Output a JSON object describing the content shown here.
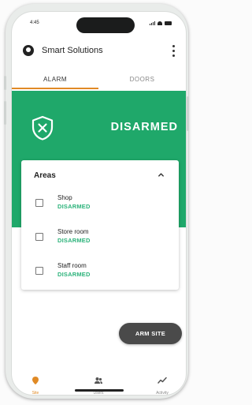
{
  "status_bar": {
    "time": "4:45"
  },
  "app_bar": {
    "title": "Smart Solutions"
  },
  "tabs": [
    {
      "label": "ALARM",
      "active": true
    },
    {
      "label": "DOORS",
      "active": false
    }
  ],
  "alarm": {
    "state": "DISARMED",
    "color": "#1fa86a"
  },
  "areas": {
    "title": "Areas",
    "items": [
      {
        "name": "Shop",
        "state": "DISARMED",
        "checked": false
      },
      {
        "name": "Store room",
        "state": "DISARMED",
        "checked": false
      },
      {
        "name": "Staff room",
        "state": "DISARMED",
        "checked": false
      }
    ]
  },
  "fab": {
    "label": "ARM SITE"
  },
  "bottom_nav": [
    {
      "label": "Site",
      "icon": "site-icon",
      "active": true
    },
    {
      "label": "Users",
      "icon": "users-icon",
      "active": false
    },
    {
      "label": "Activity",
      "icon": "activity-icon",
      "active": false
    }
  ],
  "colors": {
    "accent": "#e08a25",
    "success": "#2db37b",
    "fab": "#4a4a4a"
  }
}
